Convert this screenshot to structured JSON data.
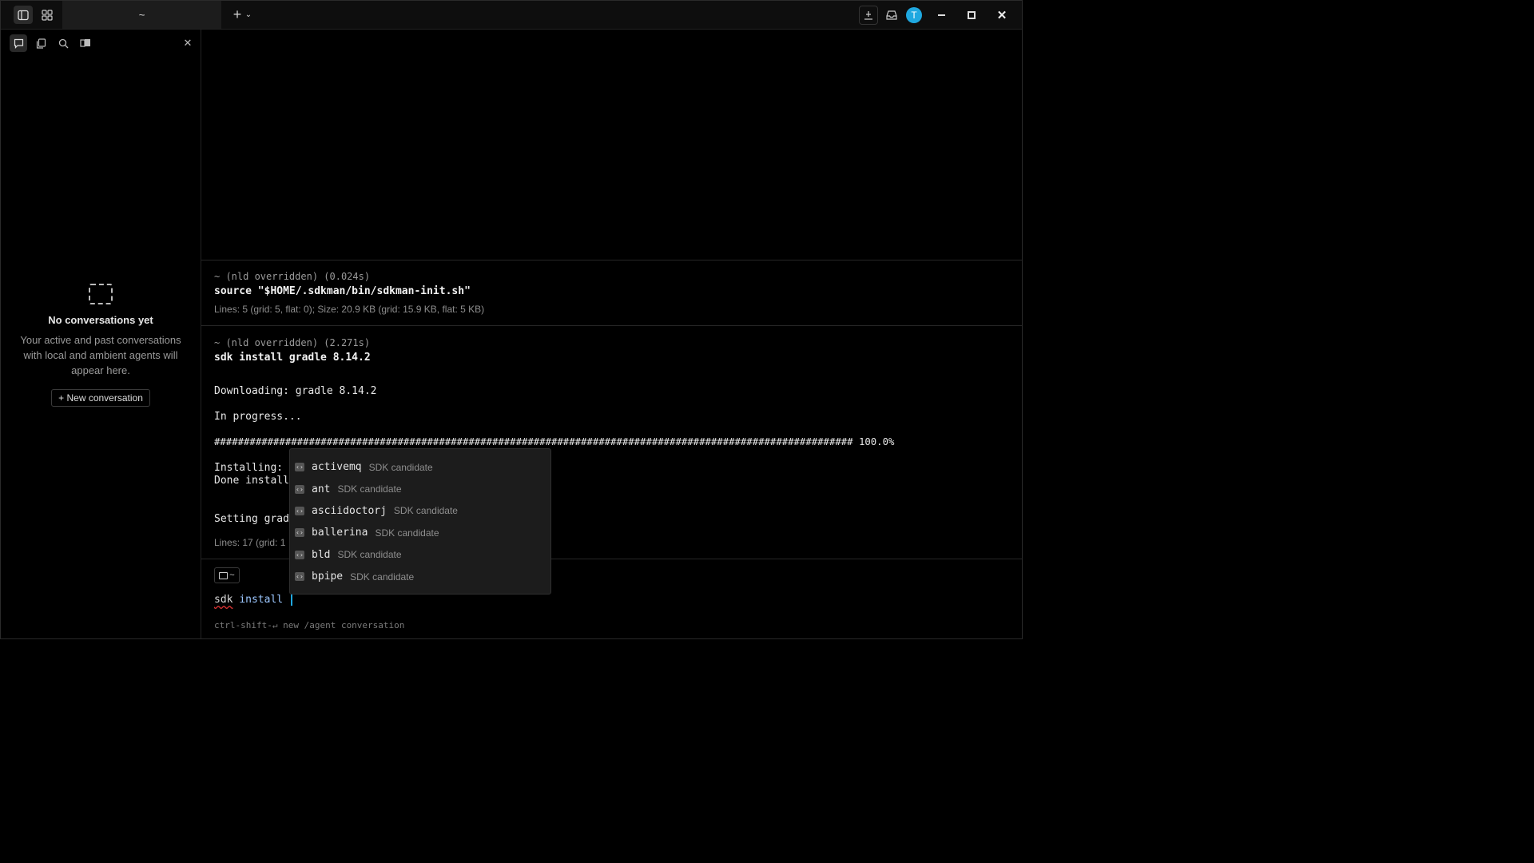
{
  "titlebar": {
    "tab_title": "~",
    "avatar_letter": "T"
  },
  "left_panel": {
    "empty_title": "No conversations yet",
    "empty_desc": "Your active and past conversations with local and ambient agents will appear here.",
    "new_conversation_label": "New conversation"
  },
  "blocks": [
    {
      "prompt": "~ (nld overridden) (0.024s)",
      "command": "source \"$HOME/.sdkman/bin/sdkman-init.sh\"",
      "meta": "Lines: 5 (grid: 5, flat: 0); Size: 20.9 KB (grid: 15.9 KB, flat: 5 KB)"
    },
    {
      "prompt": "~ (nld overridden) (2.271s)",
      "command": "sdk install gradle 8.14.2",
      "output": [
        "Downloading: gradle 8.14.2",
        "In progress...",
        "############################################################################################################ 100.0%",
        "Installing:",
        "Done install",
        "Setting grad"
      ],
      "meta": "Lines: 17 (grid: 1"
    }
  ],
  "input": {
    "dir_chip": "~",
    "text_cmd": "sdk",
    "text_arg": "install",
    "hint": "ctrl-shift-↵ new /agent conversation"
  },
  "autocomplete": [
    {
      "name": "activemq",
      "desc": "SDK candidate"
    },
    {
      "name": "ant",
      "desc": "SDK candidate"
    },
    {
      "name": "asciidoctorj",
      "desc": "SDK candidate"
    },
    {
      "name": "ballerina",
      "desc": "SDK candidate"
    },
    {
      "name": "bld",
      "desc": "SDK candidate"
    },
    {
      "name": "bpipe",
      "desc": "SDK candidate"
    }
  ]
}
